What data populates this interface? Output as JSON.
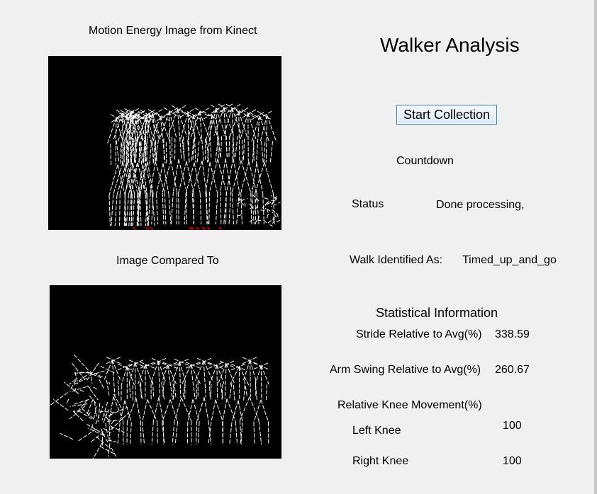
{
  "left": {
    "mei_caption": "Motion Energy Image from Kinect",
    "compared_caption": "Image Compared To"
  },
  "right": {
    "title": "Walker Analysis",
    "start_button": "Start Collection",
    "countdown_label": "Countdown",
    "status_label": "Status",
    "status_value": "Done processing, displaying image...",
    "walk_identified_label": "Walk Identified As:",
    "walk_identified_value": "Timed_up_and_go"
  },
  "stats": {
    "heading": "Statistical Information",
    "stride_label": "Stride Relative to Avg(%)",
    "stride_value": "338.59",
    "arm_swing_label": "Arm Swing Relative to Avg(%)",
    "arm_swing_value": "260.67",
    "knee_label": "Relative Knee Movement(%)",
    "left_knee_label": "Left Knee",
    "left_knee_value": "100",
    "right_knee_label": "Right Knee",
    "right_knee_value": "100"
  }
}
